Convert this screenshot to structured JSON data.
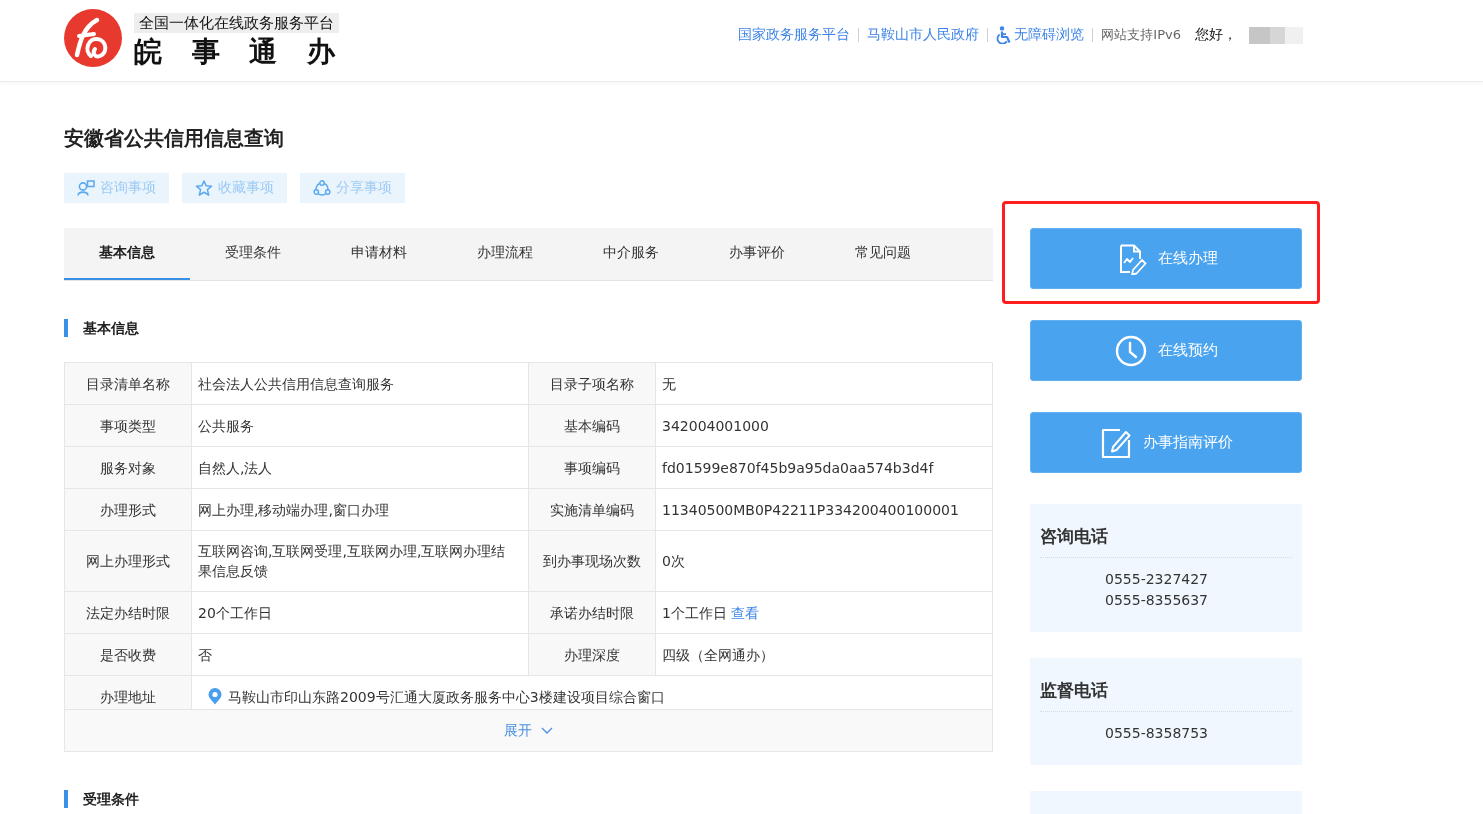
{
  "header": {
    "logo_subtitle": "全国一体化在线政务服务平台",
    "logo_title": "皖 事 通 办",
    "links": [
      {
        "kind": "link",
        "label": "国家政务服务平台"
      },
      {
        "kind": "link",
        "label": "马鞍山市人民政府"
      },
      {
        "kind": "accessibility",
        "label": "无障碍浏览"
      },
      {
        "kind": "note",
        "label": "网站支持IPv6"
      }
    ],
    "greeting": "您好，"
  },
  "page_title": "安徽省公共信用信息查询",
  "actions": [
    {
      "kind": "consult",
      "label": "咨询事项"
    },
    {
      "kind": "favorite",
      "label": "收藏事项"
    },
    {
      "kind": "share",
      "label": "分享事项"
    }
  ],
  "tabs": [
    {
      "label": "基本信息",
      "selected": true
    },
    {
      "label": "受理条件",
      "selected": false
    },
    {
      "label": "申请材料",
      "selected": false
    },
    {
      "label": "办理流程",
      "selected": false
    },
    {
      "label": "中介服务",
      "selected": false
    },
    {
      "label": "办事评价",
      "selected": false
    },
    {
      "label": "常见问题",
      "selected": false
    }
  ],
  "sections": [
    {
      "heading": "基本信息",
      "table": {
        "rows": [
          {
            "fields": [
              {
                "kind": "text",
                "label": "目录清单名称",
                "value": "社会法人公共信用信息查询服务"
              },
              {
                "kind": "text",
                "label": "目录子项名称",
                "value": "无"
              }
            ]
          },
          {
            "fields": [
              {
                "kind": "text",
                "label": "事项类型",
                "value": "公共服务"
              },
              {
                "kind": "text",
                "label": "基本编码",
                "value": "342004001000"
              }
            ]
          },
          {
            "fields": [
              {
                "kind": "text",
                "label": "服务对象",
                "value": "自然人,法人"
              },
              {
                "kind": "text",
                "label": "事项编码",
                "value": "fd01599e870f45b9a95da0aa574b3d4f"
              }
            ]
          },
          {
            "fields": [
              {
                "kind": "text",
                "label": "办理形式",
                "value": "网上办理,移动端办理,窗口办理"
              },
              {
                "kind": "text",
                "label": "实施清单编码",
                "value": "11340500MB0P42211P334200400100001"
              }
            ]
          },
          {
            "fields": [
              {
                "kind": "text",
                "label": "网上办理形式",
                "value": "互联网咨询,互联网受理,互联网办理,互联网办理结果信息反馈"
              },
              {
                "kind": "text",
                "label": "到办事现场次数",
                "value": "0次"
              }
            ]
          },
          {
            "fields": [
              {
                "kind": "text",
                "label": "法定办结时限",
                "value": "20个工作日"
              },
              {
                "kind": "text",
                "label": "承诺办结时限",
                "value": "1个工作日",
                "link": "查看"
              }
            ]
          },
          {
            "fields": [
              {
                "kind": "text",
                "label": "是否收费",
                "value": "否"
              },
              {
                "kind": "text",
                "label": "办理深度",
                "value": "四级（全网通办）"
              }
            ]
          },
          {
            "fields": [
              {
                "kind": "address",
                "label": "办理地址",
                "value": "马鞍山市印山东路2009号汇通大厦政务服务中心3楼建设项目综合窗口"
              }
            ]
          }
        ]
      },
      "expand": {
        "label": "展开",
        "expanded": false
      }
    },
    {
      "heading": "受理条件"
    }
  ],
  "side_buttons": [
    {
      "kind": "sign",
      "label": "在线办理",
      "highlighted": true
    },
    {
      "kind": "clock",
      "label": "在线预约",
      "highlighted": false
    },
    {
      "kind": "edit",
      "label": "办事指南评价",
      "highlighted": false
    }
  ],
  "contact_cards": [
    {
      "title": "咨询电话",
      "phones": [
        "0555-2327427",
        "0555-8355637"
      ]
    },
    {
      "title": "监督电话",
      "phones": [
        "0555-8358753"
      ]
    }
  ]
}
